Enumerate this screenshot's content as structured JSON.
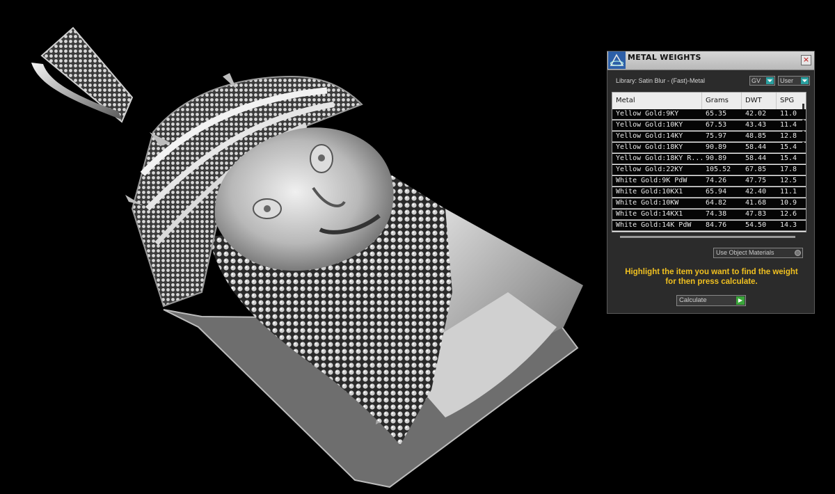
{
  "panel": {
    "title": "METAL WEIGHTS",
    "close_label": "×",
    "library_label": "Library: Satin Blur - (Fast)-Metal",
    "gv_label": "GV",
    "user_label": "User",
    "columns": [
      "Metal",
      "Grams",
      "DWT",
      "SPG"
    ],
    "rows": [
      {
        "metal": "Yellow Gold:9KY",
        "grams": "65.35",
        "dwt": "42.02",
        "spg": "11.0"
      },
      {
        "metal": "Yellow Gold:10KY",
        "grams": "67.53",
        "dwt": "43.43",
        "spg": "11.4"
      },
      {
        "metal": "Yellow Gold:14KY",
        "grams": "75.97",
        "dwt": "48.85",
        "spg": "12.8"
      },
      {
        "metal": "Yellow Gold:18KY",
        "grams": "90.89",
        "dwt": "58.44",
        "spg": "15.4"
      },
      {
        "metal": "Yellow Gold:18KY R...",
        "grams": "90.89",
        "dwt": "58.44",
        "spg": "15.4"
      },
      {
        "metal": "Yellow Gold:22KY",
        "grams": "105.52",
        "dwt": "67.85",
        "spg": "17.8"
      },
      {
        "metal": "White Gold:9K PdW",
        "grams": "74.26",
        "dwt": "47.75",
        "spg": "12.5"
      },
      {
        "metal": "White Gold:10KX1",
        "grams": "65.94",
        "dwt": "42.40",
        "spg": "11.1"
      },
      {
        "metal": "White Gold:10KW",
        "grams": "64.82",
        "dwt": "41.68",
        "spg": "10.9"
      },
      {
        "metal": "White Gold:14KX1",
        "grams": "74.38",
        "dwt": "47.83",
        "spg": "12.6"
      },
      {
        "metal": "White Gold:14K PdW",
        "grams": "84.76",
        "dwt": "54.50",
        "spg": "14.3"
      }
    ],
    "use_object_materials": "Use Object Materials",
    "hint_line1": "Highlight the item you want to find the weight",
    "hint_line2": "for then press calculate.",
    "calculate_label": "Calculate"
  },
  "colors": {
    "background": "#000000",
    "hint": "#f0c020",
    "accent": "#2aa0a0"
  }
}
